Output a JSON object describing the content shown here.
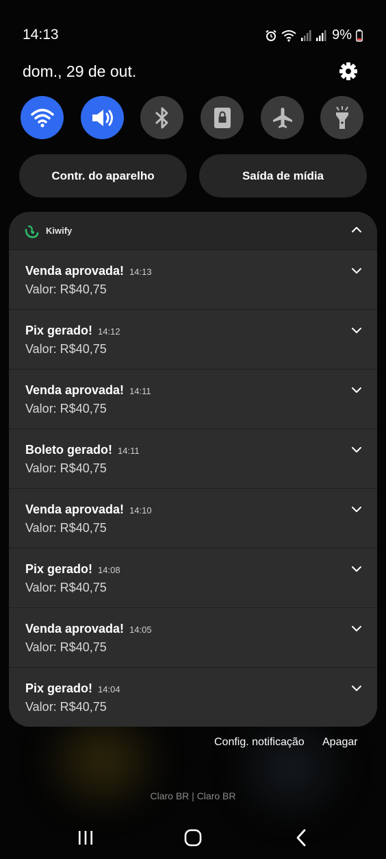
{
  "status_bar": {
    "time": "14:13",
    "battery": "9%",
    "icons": [
      "alarm-icon",
      "wifi-icon",
      "signal-icon",
      "signal-icon",
      "battery-icon"
    ]
  },
  "header": {
    "date": "dom., 29 de out."
  },
  "quick_settings": [
    {
      "name": "wifi",
      "icon": "wifi-icon",
      "active": true
    },
    {
      "name": "sound",
      "icon": "speaker-icon",
      "active": true
    },
    {
      "name": "bluetooth",
      "icon": "bluetooth-icon",
      "active": false
    },
    {
      "name": "screen-lock",
      "icon": "lock-icon",
      "active": false
    },
    {
      "name": "airplane",
      "icon": "airplane-icon",
      "active": false
    },
    {
      "name": "flashlight",
      "icon": "flashlight-icon",
      "active": false
    }
  ],
  "pills": {
    "device_control": "Contr. do aparelho",
    "media_output": "Saída de mídia"
  },
  "notification_group": {
    "app_name": "Kiwify",
    "items": [
      {
        "title": "Venda aprovada!",
        "time": "14:13",
        "body": "Valor: R$40,75"
      },
      {
        "title": "Pix gerado!",
        "time": "14:12",
        "body": "Valor: R$40,75"
      },
      {
        "title": "Venda aprovada!",
        "time": "14:11",
        "body": "Valor: R$40,75"
      },
      {
        "title": "Boleto gerado!",
        "time": "14:11",
        "body": "Valor: R$40,75"
      },
      {
        "title": "Venda aprovada!",
        "time": "14:10",
        "body": "Valor: R$40,75"
      },
      {
        "title": "Pix gerado!",
        "time": "14:08",
        "body": "Valor: R$40,75"
      },
      {
        "title": "Venda aprovada!",
        "time": "14:05",
        "body": "Valor: R$40,75"
      },
      {
        "title": "Pix gerado!",
        "time": "14:04",
        "body": "Valor: R$40,75"
      }
    ]
  },
  "footer": {
    "settings_label": "Config. notificação",
    "clear_label": "Apagar"
  },
  "carrier": "Claro BR | Claro BR",
  "colors": {
    "accent": "#2f6af0",
    "tile_off": "#3a3a3a",
    "card": "#2d2d2d",
    "kiwify_green": "#2bbf6a"
  }
}
